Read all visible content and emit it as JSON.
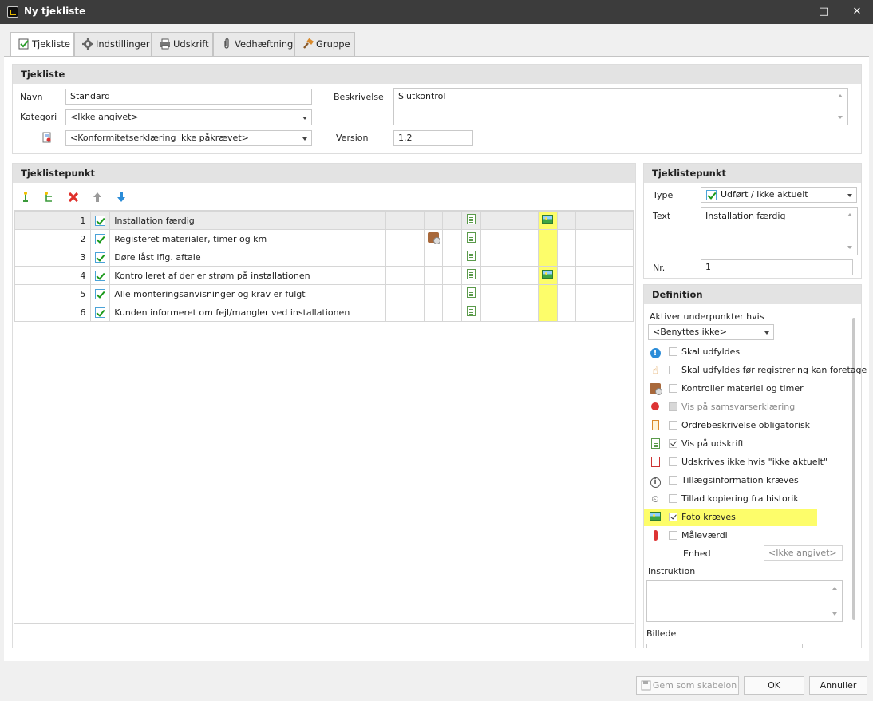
{
  "window": {
    "title": "Ny tjekliste",
    "maximize_glyph": "□",
    "close_glyph": "✕"
  },
  "tabs": [
    {
      "label": "Tjekliste",
      "icon": "checklist-icon"
    },
    {
      "label": "Indstillinger",
      "icon": "gear-icon"
    },
    {
      "label": "Udskrift",
      "icon": "printer-icon"
    },
    {
      "label": "Vedhæftning",
      "icon": "paperclip-icon"
    },
    {
      "label": "Gruppe",
      "icon": "hammer-icon"
    }
  ],
  "header_section": {
    "title": "Tjekliste",
    "navn_label": "Navn",
    "navn_value": "Standard",
    "kategori_label": "Kategori",
    "kategori_value": "<Ikke angivet>",
    "konformitet_value": "<Konformitetserklæring ikke påkrævet>",
    "beskrivelse_label": "Beskrivelse",
    "beskrivelse_value": "Slutkontrol",
    "version_label": "Version",
    "version_value": "1.2"
  },
  "items_section": {
    "title": "Tjeklistepunkt",
    "toolbar": [
      "add-item-icon",
      "add-subitem-icon",
      "delete-icon",
      "move-up-icon",
      "move-down-icon"
    ],
    "rows": [
      {
        "nr": "1",
        "text": "Installation færdig",
        "material": false,
        "photo": true,
        "selected": true
      },
      {
        "nr": "2",
        "text": "Registeret materialer, timer og km",
        "material": true,
        "photo": false,
        "selected": false
      },
      {
        "nr": "3",
        "text": "Døre låst iflg. aftale",
        "material": false,
        "photo": false,
        "selected": false
      },
      {
        "nr": "4",
        "text": "Kontrolleret af der er strøm på installationen",
        "material": false,
        "photo": true,
        "selected": false
      },
      {
        "nr": "5",
        "text": "Alle monteringsanvisninger og krav er fulgt",
        "material": false,
        "photo": false,
        "selected": false
      },
      {
        "nr": "6",
        "text": "Kunden informeret om fejl/mangler ved installationen",
        "material": false,
        "photo": false,
        "selected": false
      }
    ]
  },
  "detail_section": {
    "title": "Tjeklistepunkt",
    "type_label": "Type",
    "type_value": "Udført / Ikke aktuelt",
    "text_label": "Text",
    "text_value": "Installation færdig",
    "nr_label": "Nr.",
    "nr_value": "1"
  },
  "definition_section": {
    "title": "Definition",
    "aktiver_label": "Aktiver underpunkter hvis",
    "aktiver_value": "<Benyttes ikke>",
    "options": [
      {
        "label": "Skal udfyldes",
        "icon": "exclamation-icon",
        "checked": false,
        "disabled": false
      },
      {
        "label": "Skal udfyldes før registrering kan foretage",
        "icon": "hand-icon",
        "checked": false,
        "disabled": false
      },
      {
        "label": "Kontroller materiel og timer",
        "icon": "box-icon",
        "checked": false,
        "disabled": false
      },
      {
        "label": "Vis på samsvarserklæring",
        "icon": "ribbon-icon",
        "checked": false,
        "disabled": true
      },
      {
        "label": "Ordrebeskrivelse obligatorisk",
        "icon": "clipboard-icon",
        "checked": false,
        "disabled": false
      },
      {
        "label": "Vis på udskrift",
        "icon": "document-icon",
        "checked": true,
        "disabled": false
      },
      {
        "label": "Udskrives ikke hvis \"ikke aktuelt\"",
        "icon": "document-red-icon",
        "checked": false,
        "disabled": false
      },
      {
        "label": "Tillægsinformation kræves",
        "icon": "info-icon",
        "checked": false,
        "disabled": false
      },
      {
        "label": "Tillad kopiering fra historik",
        "icon": "history-icon",
        "checked": false,
        "disabled": false
      },
      {
        "label": "Foto kræves",
        "icon": "photo-icon",
        "checked": true,
        "disabled": false
      },
      {
        "label": "Måleværdi",
        "icon": "thermometer-icon",
        "checked": false,
        "disabled": false
      }
    ],
    "enhed_label": "Enhed",
    "enhed_value": "<Ikke angivet>",
    "instruktion_label": "Instruktion",
    "billede_label": "Billede"
  },
  "footer": {
    "template_label": "Gem som skabelon",
    "ok_label": "OK",
    "cancel_label": "Annuller"
  },
  "colors": {
    "highlight": "#fdfd6a",
    "titlebar": "#3c3c3c",
    "accent": "#2b8cd8"
  }
}
